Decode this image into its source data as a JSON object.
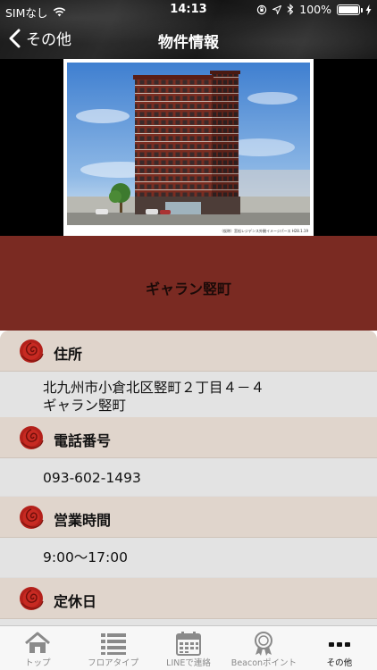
{
  "status_bar": {
    "carrier": "SIMなし",
    "time": "14:13",
    "battery": "100%",
    "battery_level": 1.0
  },
  "nav": {
    "back_label": "その他",
    "title": "物件情報"
  },
  "hero": {
    "caption": "（仮称）宮松レジデンス外観イメージパース H28.1.19"
  },
  "property": {
    "name": "ギャラン竪町"
  },
  "sections": [
    {
      "id": "address",
      "label": "住所",
      "lines": [
        "北九州市小倉北区竪町２丁目４－４",
        "ギャラン竪町"
      ]
    },
    {
      "id": "phone",
      "label": "電話番号",
      "lines": [
        "093-602-1493"
      ]
    },
    {
      "id": "hours",
      "label": "営業時間",
      "lines": [
        "9:00〜17:00"
      ]
    },
    {
      "id": "holiday",
      "label": "定休日",
      "lines": []
    }
  ],
  "tabs": [
    {
      "label": "トップ",
      "icon": "home-icon"
    },
    {
      "label": "フロアタイプ",
      "icon": "list-icon"
    },
    {
      "label": "LINEで連絡",
      "icon": "calendar-icon"
    },
    {
      "label": "Beaconポイント",
      "icon": "badge-icon"
    },
    {
      "label": "その他",
      "icon": "more-icon"
    }
  ],
  "colors": {
    "name_band": "#7a2a22",
    "section_header": "#e0d5cc",
    "phone_link": "#1a2ec8",
    "rose": "#b3201a"
  }
}
